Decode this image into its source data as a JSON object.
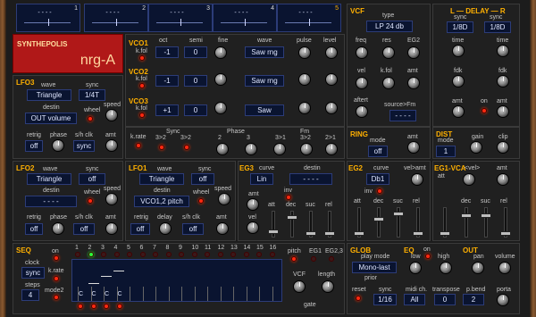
{
  "title": {
    "brand": "SYNTHEPOLIS",
    "preset": "nrg-A"
  },
  "top_displays": [
    {
      "n": "1",
      "value": "- - - -"
    },
    {
      "n": "2",
      "value": "- - - -"
    },
    {
      "n": "3",
      "value": "- - - -"
    },
    {
      "n": "4",
      "value": "- - - -"
    },
    {
      "n": "5",
      "value": "- - - -"
    }
  ],
  "vco": {
    "headers": {
      "oct": "oct",
      "semi": "semi",
      "fine": "fine",
      "wave": "wave",
      "pulse": "pulse",
      "level": "level",
      "kfol": "k.fol"
    },
    "rows": [
      {
        "name": "VCO1",
        "oct": "-1",
        "semi": "0",
        "wave": "Saw rng"
      },
      {
        "name": "VCO2",
        "oct": "-1",
        "semi": "0",
        "wave": "Saw rng"
      },
      {
        "name": "VCO3",
        "oct": "+1",
        "semi": "0",
        "wave": "Saw"
      }
    ],
    "krate": "k.rate",
    "sync_label": "Sync",
    "sync_a": "3>2",
    "sync_b": "3>2",
    "phase_label": "Phase",
    "fm_label": "Fm",
    "bottom": [
      "2",
      "3",
      "3>1",
      "3>2",
      "2>1"
    ]
  },
  "lfo3": {
    "title": "LFO3",
    "wave_l": "wave",
    "wave": "Triangle",
    "sync_l": "sync",
    "sync": "1/4T",
    "destin_l": "destin",
    "destin": "OUT volume",
    "wheel": "wheel",
    "speed": "speed",
    "retrig_l": "retrig",
    "retrig": "off",
    "phase": "phase",
    "shclk_l": "s/h clk",
    "shclk": "sync",
    "amt": "amt"
  },
  "lfo2": {
    "title": "LFO2",
    "wave_l": "wave",
    "wave": "Triangle",
    "sync_l": "sync",
    "sync": "off",
    "destin_l": "destin",
    "destin": "- - - -",
    "wheel": "wheel",
    "speed": "speed",
    "retrig_l": "retrig",
    "retrig": "off",
    "phase": "phase",
    "shclk_l": "s/h clk",
    "shclk": "off",
    "amt": "amt"
  },
  "lfo1": {
    "title": "LFO1",
    "wave_l": "wave",
    "wave": "Triangle",
    "sync_l": "sync",
    "sync": "off",
    "destin_l": "destin",
    "destin": "VCO1,2 pitch",
    "wheel": "wheel",
    "speed": "speed",
    "retrig_l": "retrig",
    "retrig": "off",
    "delay": "delay",
    "shclk_l": "s/h clk",
    "shclk": "off",
    "amt": "amt"
  },
  "eg3": {
    "title": "EG3",
    "curve_l": "curve",
    "curve": "Lin",
    "destin_l": "destin",
    "destin": "- - - -",
    "inv": "inv",
    "amt": "amt",
    "vel": "vel",
    "att": "att",
    "dec": "dec",
    "suc": "suc",
    "rel": "rel"
  },
  "vcf": {
    "title": "VCF",
    "type_l": "type",
    "type": "LP 24 db",
    "freq": "freq",
    "res": "res",
    "eg2": "EG2",
    "vel": "vel",
    "kfol": "k.fol",
    "amt": "amt",
    "aftert": "aftert",
    "source_l": "source>Fm",
    "source": "- - - -"
  },
  "delay": {
    "title": "L — DELAY — R",
    "sync_l": "sync",
    "sync_r": "sync",
    "sync_l_val": "1/8D",
    "sync_r_val": "1/8D",
    "time": "time",
    "fdk": "fdk",
    "amt": "amt",
    "on": "on"
  },
  "ring": {
    "title": "RING",
    "mode_l": "mode",
    "mode": "off",
    "amt": "amt"
  },
  "dist": {
    "title": "DIST",
    "mode_l": "mode",
    "mode": "1",
    "gain": "gain",
    "clip": "clip"
  },
  "eg2": {
    "title": "EG2",
    "curve_l": "curve",
    "curve": "Db1",
    "velamt": "vel>amt",
    "inv": "inv",
    "att": "att",
    "dec": "dec",
    "suc": "suc",
    "rel": "rel"
  },
  "eg1": {
    "title": "EG1-VCA",
    "att": "att",
    "velamt": "<vel>",
    "amt": "amt",
    "dec": "dec",
    "suc": "suc",
    "rel": "rel"
  },
  "seq": {
    "title": "SEQ",
    "on": "on",
    "clock_l": "clock",
    "clock": "sync",
    "krate": "k.rate",
    "steps_l": "steps",
    "steps": "4",
    "mode2": "mode2",
    "step_numbers": [
      "1",
      "2",
      "3",
      "4",
      "5",
      "6",
      "7",
      "8",
      "9",
      "10",
      "11",
      "12",
      "13",
      "14",
      "15",
      "16"
    ],
    "notes": [
      "C",
      "C",
      "C",
      "C"
    ],
    "pitch": "pitch",
    "eg1": "EG1",
    "eg23": "EG2,3",
    "vcf": "VCF",
    "length": "length",
    "gate": "gate"
  },
  "glob": {
    "title": "GLOB",
    "play_mode_l": "play mode",
    "play_mode": "Mono-last",
    "prior": "prior",
    "reset": "reset",
    "sync_l": "sync",
    "sync": "1/16",
    "midich_l": "midi ch.",
    "midich": "All",
    "transpose_l": "transpose",
    "transpose": "0",
    "pbend_l": "p.bend",
    "pbend": "2",
    "porta": "porta"
  },
  "eq": {
    "title": "EQ",
    "on": "on",
    "low": "low",
    "high": "high"
  },
  "out": {
    "title": "OUT",
    "pan": "pan",
    "volume": "volume"
  },
  "colors": {
    "accent": "#ffb000",
    "logo_bg": "#b01818",
    "display_bg": "#0a1430",
    "led": "#ff2a10"
  }
}
